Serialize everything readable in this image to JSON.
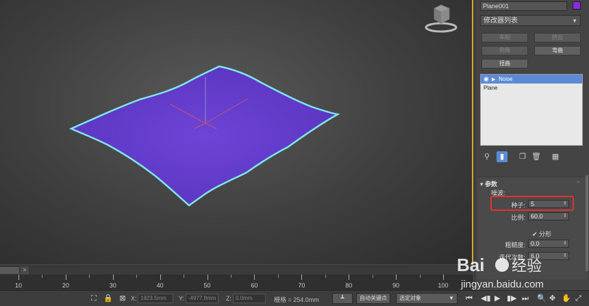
{
  "object": {
    "name": "Plane001",
    "color": "#8a2be2"
  },
  "modifier_list": {
    "label": "修改器列表"
  },
  "quick_buttons": [
    {
      "label": "车削",
      "enabled": false
    },
    {
      "label": "挤出",
      "enabled": false
    },
    {
      "label": "倒角",
      "enabled": false
    },
    {
      "label": "弯曲",
      "enabled": true
    },
    {
      "label": "扭曲",
      "enabled": true
    }
  ],
  "stack": [
    {
      "label": "Noise",
      "selected": true
    },
    {
      "label": "Plane",
      "selected": false
    }
  ],
  "rollout": {
    "title": "参数",
    "group": "噪波:",
    "seed_label": "种子:",
    "seed_value": "5",
    "scale_label": "比例:",
    "scale_value": "60.0",
    "fractal_label": "分形",
    "roughness_label": "粗糙度:",
    "roughness_value": "0.0",
    "iterations_label": "迭代次数:",
    "iterations_value": "6.0"
  },
  "timeline": {
    "next_label": ">",
    "ticks": [
      "10",
      "20",
      "30",
      "40",
      "50",
      "60",
      "70",
      "80",
      "90",
      "100"
    ]
  },
  "status": {
    "x_label": "X:",
    "x_value": "1923.5mm",
    "y_label": "Y:",
    "y_value": "-4977.8mm",
    "z_label": "Z:",
    "z_value": "0.0mm",
    "grid": "栅格 = 254.0mm",
    "autokey": "自动关键点",
    "selection": "选定对象"
  },
  "watermark": {
    "brand": "Bai",
    "brand2": "经验",
    "url": "jingyan.baidu.com"
  },
  "colors": {
    "plane": "#6a3fd0",
    "selection": "#7fe6ee",
    "accent": "#d9a52b",
    "highlight": "#e2332c"
  }
}
